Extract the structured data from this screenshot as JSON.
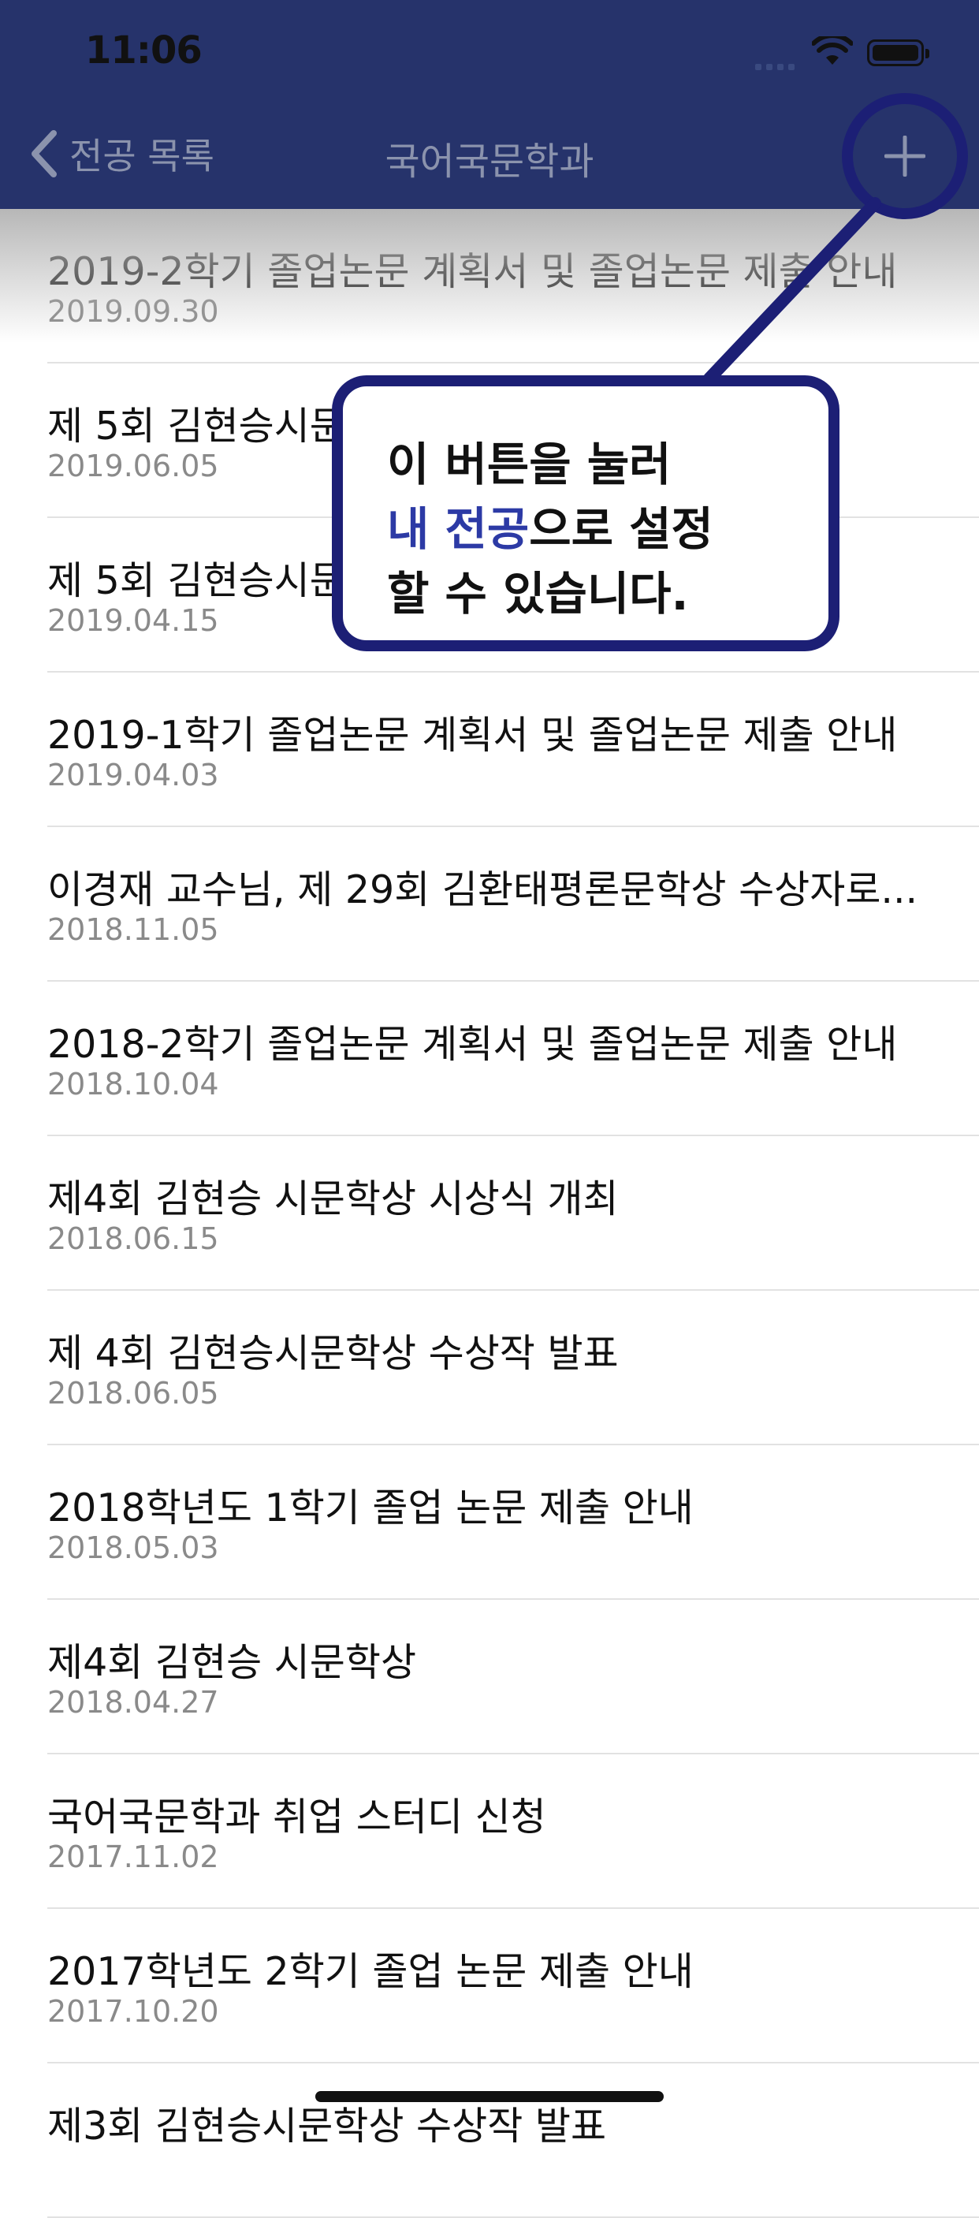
{
  "status_bar": {
    "time": "11:06"
  },
  "nav": {
    "back_label": "전공 목록",
    "title": "국어국문학과",
    "add_icon": "plus-icon"
  },
  "tooltip": {
    "line1": "이 버튼을 눌러",
    "line2_accent": "내 전공",
    "line2_rest": "으로 설정",
    "line3": "할 수 있습니다.",
    "accent_color": "#2c3aa5",
    "border_color": "#1c1f75"
  },
  "notices": [
    {
      "title": "2019-2학기 졸업논문 계획서 및 졸업논문 제출 안내",
      "date": "2019.09.30"
    },
    {
      "title": "제 5회 김현승시문",
      "date": "2019.06.05"
    },
    {
      "title": "제 5회 김현승시문",
      "date": "2019.04.15"
    },
    {
      "title": "2019-1학기 졸업논문 계획서 및 졸업논문 제출 안내",
      "date": "2019.04.03"
    },
    {
      "title": "이경재 교수님, 제 29회 김환태평론문학상 수상자로...",
      "date": "2018.11.05"
    },
    {
      "title": "2018-2학기 졸업논문 계획서 및 졸업논문 제출 안내",
      "date": "2018.10.04"
    },
    {
      "title": "제4회 김현승 시문학상 시상식 개최",
      "date": "2018.06.15"
    },
    {
      "title": "제 4회 김현승시문학상 수상작 발표",
      "date": "2018.06.05"
    },
    {
      "title": "2018학년도 1학기 졸업 논문 제출 안내",
      "date": "2018.05.03"
    },
    {
      "title": "제4회 김현승 시문학상",
      "date": "2018.04.27"
    },
    {
      "title": "국어국문학과 취업 스터디 신청",
      "date": "2017.11.02"
    },
    {
      "title": "2017학년도 2학기 졸업 논문 제출 안내",
      "date": "2017.10.20"
    },
    {
      "title": "제3회 김현승시문학상 수상작 발표",
      "date": ""
    }
  ],
  "colors": {
    "nav_bg": "#26336b",
    "date_text": "#8a8a8a"
  }
}
